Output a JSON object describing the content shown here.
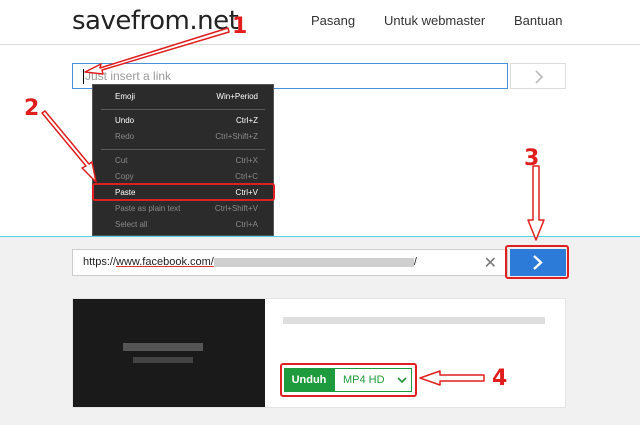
{
  "header": {
    "logo": "savefrom.net",
    "nav": [
      "Pasang",
      "Untuk webmaster",
      "Bantuan"
    ]
  },
  "search_top": {
    "placeholder": "Just insert a link"
  },
  "context_menu": {
    "items": [
      {
        "label": "Emoji",
        "shortcut": "Win+Period",
        "enabled": true
      },
      {
        "label": "Undo",
        "shortcut": "Ctrl+Z",
        "enabled": true
      },
      {
        "label": "Redo",
        "shortcut": "Ctrl+Shift+Z",
        "enabled": false
      },
      {
        "label": "Cut",
        "shortcut": "Ctrl+X",
        "enabled": false
      },
      {
        "label": "Copy",
        "shortcut": "Ctrl+C",
        "enabled": false
      },
      {
        "label": "Paste",
        "shortcut": "Ctrl+V",
        "enabled": true,
        "highlighted": true
      },
      {
        "label": "Paste as plain text",
        "shortcut": "Ctrl+Shift+V",
        "enabled": false
      },
      {
        "label": "Select all",
        "shortcut": "Ctrl+A",
        "enabled": false
      }
    ]
  },
  "search_filled": {
    "value_prefix": "https://",
    "value_domain": "www.facebook.com/",
    "value_suffix": "/",
    "clear_glyph": "✕"
  },
  "result": {
    "download_label": "Unduh",
    "format_label": "MP4  HD"
  },
  "annotations": {
    "step1": "1",
    "step2": "2",
    "step3": "3",
    "step4": "4"
  },
  "colors": {
    "accent_blue": "#2d7bd9",
    "download_green": "#1e9b3c",
    "annotation_red": "#e01e1e"
  }
}
